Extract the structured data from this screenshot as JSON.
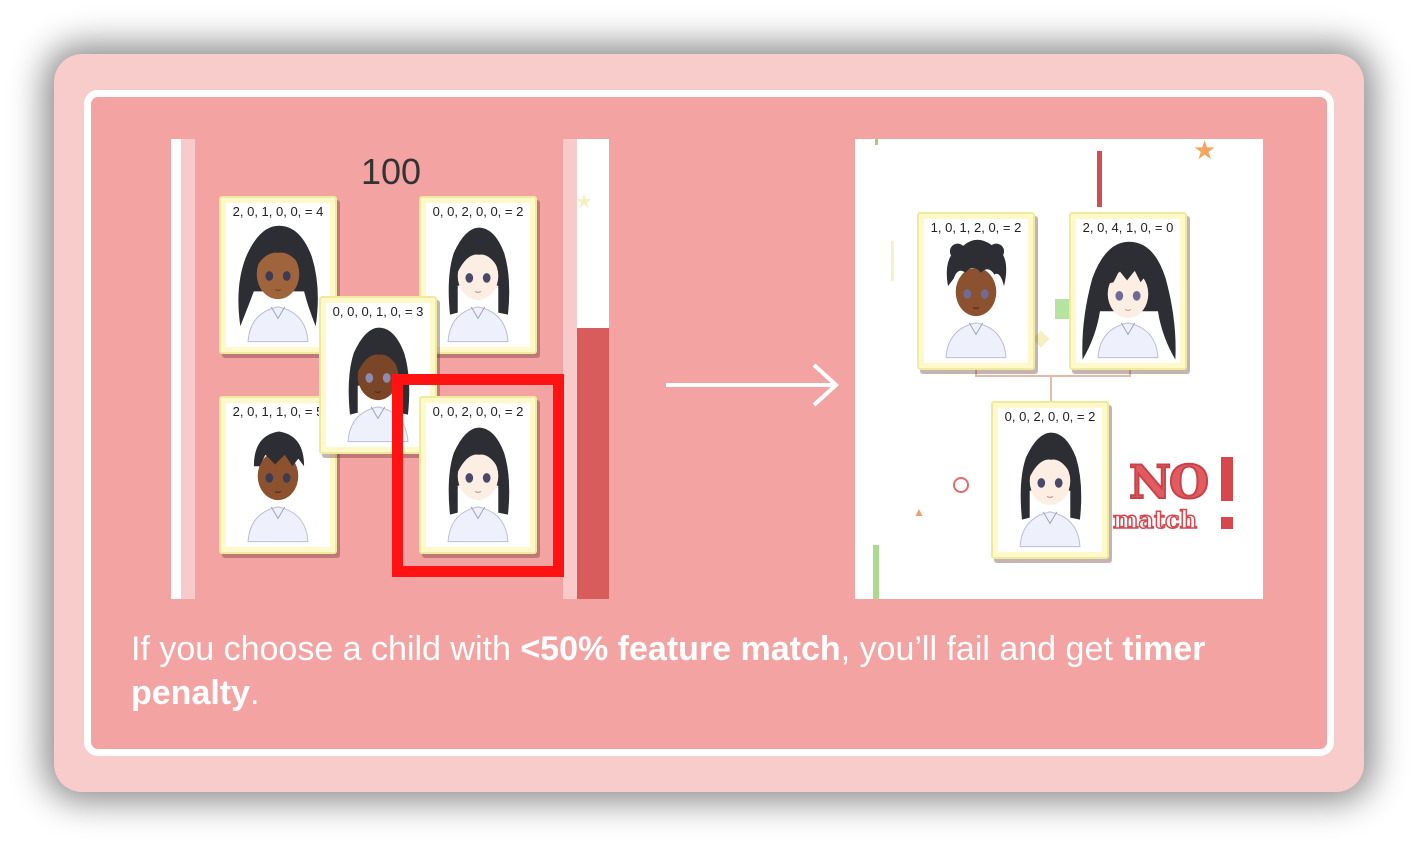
{
  "game": {
    "score": "100",
    "timer_fraction": 0.59,
    "left_cards": [
      {
        "label": "2, 0, 1, 0, 0, = 4"
      },
      {
        "label": "0, 0, 2, 0, 0, = 2"
      },
      {
        "label": "0, 0, 0, 1, 0, = 3"
      },
      {
        "label": "2, 0, 1, 1, 0, = 5"
      },
      {
        "label": "0, 0, 2, 0, 0, = 2"
      }
    ],
    "result_cards": [
      {
        "label": "1, 0, 1, 2, 0, = 2"
      },
      {
        "label": "2, 0, 4, 1, 0, = 0"
      },
      {
        "label": "0, 0, 2, 0, 0, = 2"
      }
    ],
    "stamp": {
      "no": "NO",
      "match": "match"
    }
  },
  "caption": {
    "part1": "If you choose a child with ",
    "bold1": "<50% feature match",
    "part2": ", you’ll fail and get ",
    "bold2": "timer penalty",
    "part3": "."
  },
  "colors": {
    "background_outer": "#f9cccc",
    "background_inner": "#f4a3a3",
    "highlight": "#ff1212",
    "timer_fill": "#d95c5c",
    "card": "#fff8c9"
  },
  "icons": [
    "right-arrow-icon",
    "star-icon"
  ]
}
